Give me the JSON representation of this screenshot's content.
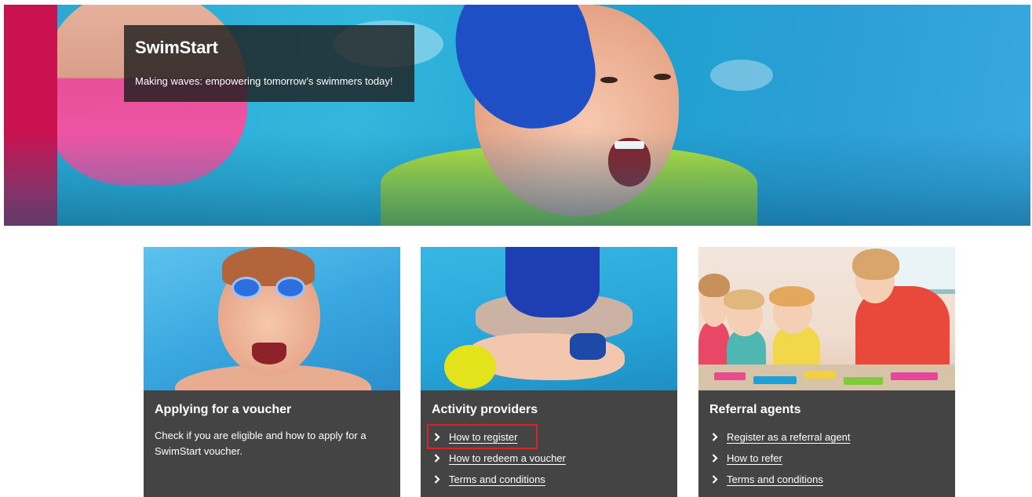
{
  "hero": {
    "title": "SwimStart",
    "tagline": "Making waves: empowering tomorrow’s swimmers today!"
  },
  "cards": [
    {
      "title": "Applying for a voucher",
      "text": "Check if you are eligible and how to apply for a SwimStart voucher.",
      "links": []
    },
    {
      "title": "Activity providers",
      "links": [
        "How to register",
        "How to redeem a voucher",
        "Terms and conditions"
      ]
    },
    {
      "title": "Referral agents",
      "links": [
        "Register as a referral agent",
        "How to refer",
        "Terms and conditions"
      ]
    }
  ],
  "colors": {
    "brand_magenta": "#c9124f",
    "card_background": "#444444",
    "highlight_border": "#d8232a"
  }
}
